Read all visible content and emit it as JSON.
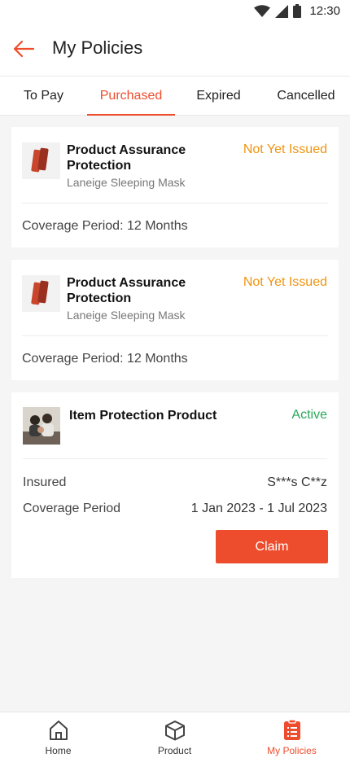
{
  "status_bar": {
    "time": "12:30",
    "icons": [
      "wifi-icon",
      "signal-icon",
      "battery-icon"
    ]
  },
  "header": {
    "title": "My Policies",
    "back_icon": "arrow-left-icon"
  },
  "tabs": [
    {
      "label": "To Pay",
      "active": false
    },
    {
      "label": "Purchased",
      "active": true
    },
    {
      "label": "Expired",
      "active": false
    },
    {
      "label": "Cancelled",
      "active": false
    }
  ],
  "policies": [
    {
      "product_name": "Product Assurance Protection",
      "product_subtitle": "Laneige Sleeping Mask",
      "status": "Not Yet Issued",
      "coverage": "Coverage Period: 12 Months"
    },
    {
      "product_name": "Product Assurance Protection",
      "product_subtitle": "Laneige Sleeping Mask",
      "status": "Not Yet Issued",
      "coverage": "Coverage Period: 12 Months"
    },
    {
      "product_name": "Item Protection Product",
      "status": "Active",
      "insured_label": "Insured",
      "insured_value": "S***s C**z",
      "coverage_label": "Coverage Period",
      "coverage_value": "1 Jan 2023 - 1 Jul 2023",
      "claim_label": "Claim"
    }
  ],
  "bottom_nav": [
    {
      "label": "Home",
      "icon": "home-icon",
      "active": false
    },
    {
      "label": "Product",
      "icon": "box-icon",
      "active": false
    },
    {
      "label": "My Policies",
      "icon": "policy-list-icon",
      "active": true
    }
  ],
  "colors": {
    "accent": "#ee4d2d",
    "pending": "#f09410",
    "active": "#26aa59"
  }
}
